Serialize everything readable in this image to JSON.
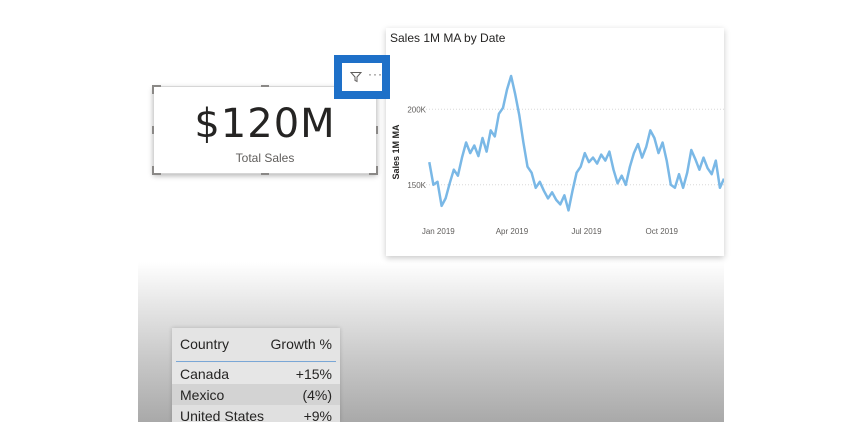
{
  "kpi": {
    "value": "$120M",
    "label": "Total Sales"
  },
  "visual_header": {
    "icons": [
      "filter-icon",
      "more-options-icon"
    ],
    "more_label": "···",
    "accent_color": "#1e70c8"
  },
  "chart_data": {
    "type": "line",
    "title": "Sales 1M MA by Date",
    "ylabel": "Sales 1M MA",
    "xlabel": "",
    "x_ticks": [
      "Jan 2019",
      "Apr 2019",
      "Jul 2019",
      "Oct 2019"
    ],
    "y_ticks": [
      "200K",
      "150K"
    ],
    "y_tick_values": [
      200000,
      150000
    ],
    "ylim": [
      128000,
      226000
    ],
    "x_tick_dates": [
      "2019-01-01",
      "2019-04-01",
      "2019-07-01",
      "2019-10-01"
    ],
    "xlim": [
      "2018-12-17",
      "2019-12-16"
    ],
    "grid": true,
    "line_color": "#7ab8e6",
    "series": [
      {
        "x": [
          "2018-12-21",
          "2018-12-26",
          "2018-12-31",
          "2019-01-05",
          "2019-01-10",
          "2019-01-15",
          "2019-01-20",
          "2019-01-25",
          "2019-01-30",
          "2019-02-04",
          "2019-02-09",
          "2019-02-14",
          "2019-02-19",
          "2019-02-24",
          "2019-03-01",
          "2019-03-06",
          "2019-03-11",
          "2019-03-16",
          "2019-03-21",
          "2019-03-26",
          "2019-03-31",
          "2019-04-05",
          "2019-04-10",
          "2019-04-15",
          "2019-04-20",
          "2019-04-25",
          "2019-04-30",
          "2019-05-05",
          "2019-05-10",
          "2019-05-15",
          "2019-05-20",
          "2019-05-25",
          "2019-05-30",
          "2019-06-04",
          "2019-06-09",
          "2019-06-14",
          "2019-06-19",
          "2019-06-24",
          "2019-06-29",
          "2019-07-04",
          "2019-07-09",
          "2019-07-14",
          "2019-07-19",
          "2019-07-24",
          "2019-07-29",
          "2019-08-03",
          "2019-08-08",
          "2019-08-13",
          "2019-08-18",
          "2019-08-23",
          "2019-08-28",
          "2019-09-02",
          "2019-09-07",
          "2019-09-12",
          "2019-09-17",
          "2019-09-22",
          "2019-09-27",
          "2019-10-02",
          "2019-10-07",
          "2019-10-12",
          "2019-10-17",
          "2019-10-22",
          "2019-10-27",
          "2019-11-01",
          "2019-11-06",
          "2019-11-11",
          "2019-11-16",
          "2019-11-21",
          "2019-11-26",
          "2019-12-01",
          "2019-12-06",
          "2019-12-11",
          "2019-12-16"
        ],
        "values": [
          165000,
          150000,
          152000,
          136000,
          141000,
          151000,
          160000,
          156000,
          168000,
          178000,
          171000,
          176000,
          169000,
          181000,
          172000,
          186000,
          182000,
          197000,
          201000,
          213000,
          222000,
          210000,
          196000,
          178000,
          162000,
          158000,
          148000,
          152000,
          146000,
          141000,
          145000,
          140000,
          137000,
          143000,
          133000,
          146000,
          158000,
          162000,
          171000,
          165000,
          168000,
          164000,
          170000,
          166000,
          172000,
          160000,
          151000,
          156000,
          150000,
          162000,
          171000,
          177000,
          168000,
          175000,
          186000,
          181000,
          171000,
          178000,
          166000,
          150000,
          148000,
          157000,
          148000,
          158000,
          173000,
          167000,
          160000,
          168000,
          161000,
          157000,
          166000,
          148000,
          154000
        ]
      }
    ]
  },
  "table": {
    "headers": [
      "Country",
      "Growth %"
    ],
    "rows": [
      [
        "Canada",
        "+15%"
      ],
      [
        "Mexico",
        "(4%)"
      ],
      [
        "United States",
        "+9%"
      ]
    ]
  }
}
